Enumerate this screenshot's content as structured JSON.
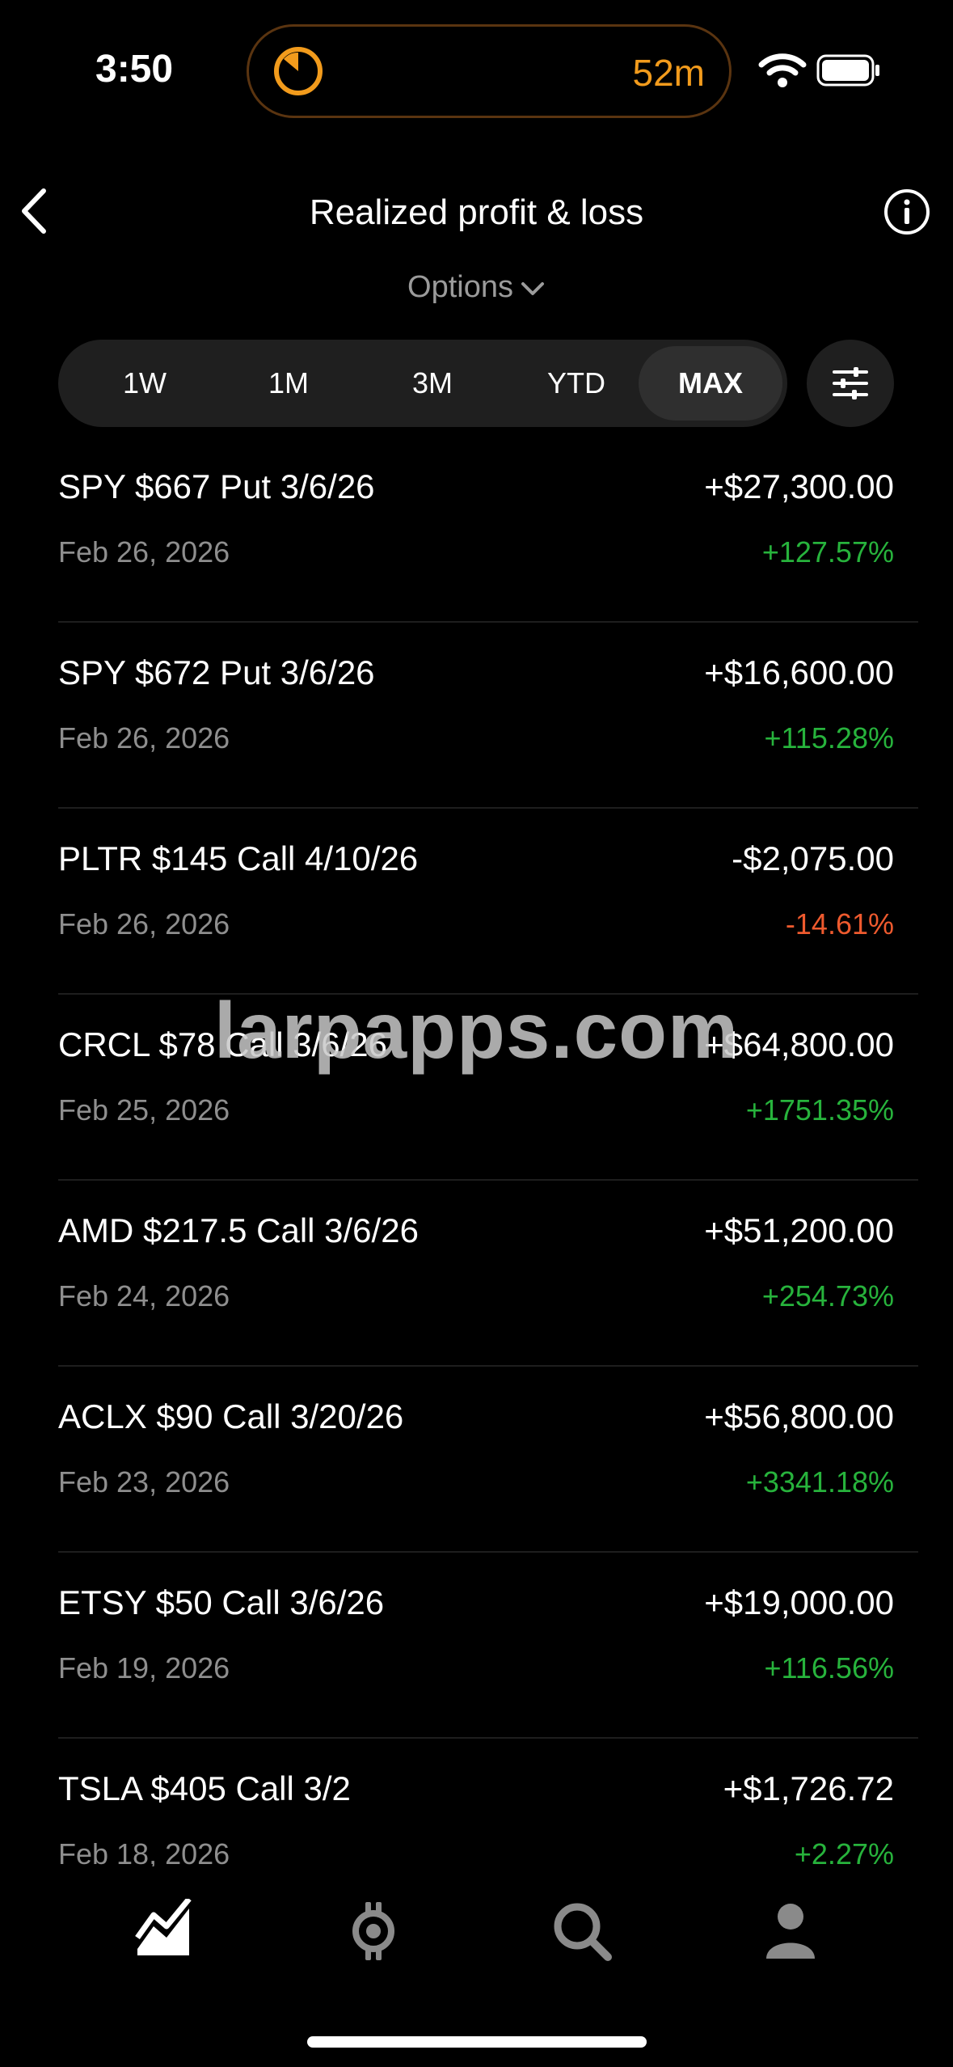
{
  "status": {
    "time": "3:50",
    "timer_label": "52m"
  },
  "header": {
    "title": "Realized profit & loss",
    "filter": "Options"
  },
  "periods": [
    "1W",
    "1M",
    "3M",
    "YTD",
    "MAX"
  ],
  "active_period": "MAX",
  "trades": [
    {
      "name": "SPY $667 Put 3/6/26",
      "amount": "+$27,300.00",
      "date": "Feb 26, 2026",
      "pct": "+127.57%",
      "direction": "up"
    },
    {
      "name": "SPY $672 Put 3/6/26",
      "amount": "+$16,600.00",
      "date": "Feb 26, 2026",
      "pct": "+115.28%",
      "direction": "up"
    },
    {
      "name": "PLTR $145 Call 4/10/26",
      "amount": "-$2,075.00",
      "date": "Feb 26, 2026",
      "pct": "-14.61%",
      "direction": "down"
    },
    {
      "name": "CRCL $78 Call 3/6/26",
      "amount": "+$64,800.00",
      "date": "Feb 25, 2026",
      "pct": "+1751.35%",
      "direction": "up"
    },
    {
      "name": "AMD $217.5 Call 3/6/26",
      "amount": "+$51,200.00",
      "date": "Feb 24, 2026",
      "pct": "+254.73%",
      "direction": "up"
    },
    {
      "name": "ACLX $90 Call 3/20/26",
      "amount": "+$56,800.00",
      "date": "Feb 23, 2026",
      "pct": "+3341.18%",
      "direction": "up"
    },
    {
      "name": "ETSY $50 Call 3/6/26",
      "amount": "+$19,000.00",
      "date": "Feb 19, 2026",
      "pct": "+116.56%",
      "direction": "up"
    },
    {
      "name": "TSLA $405 Call 3/2",
      "amount": "+$1,726.72",
      "date": "Feb 18, 2026",
      "pct": "+2.27%",
      "direction": "up"
    }
  ],
  "watermark": "larpapps.com",
  "colors": {
    "gain": "#27b33c",
    "loss": "#ee5a2e",
    "timer": "#f29b1c"
  },
  "icons": {
    "tab_bar": [
      "chart-icon",
      "crypto-icon",
      "search-icon",
      "account-icon"
    ]
  }
}
